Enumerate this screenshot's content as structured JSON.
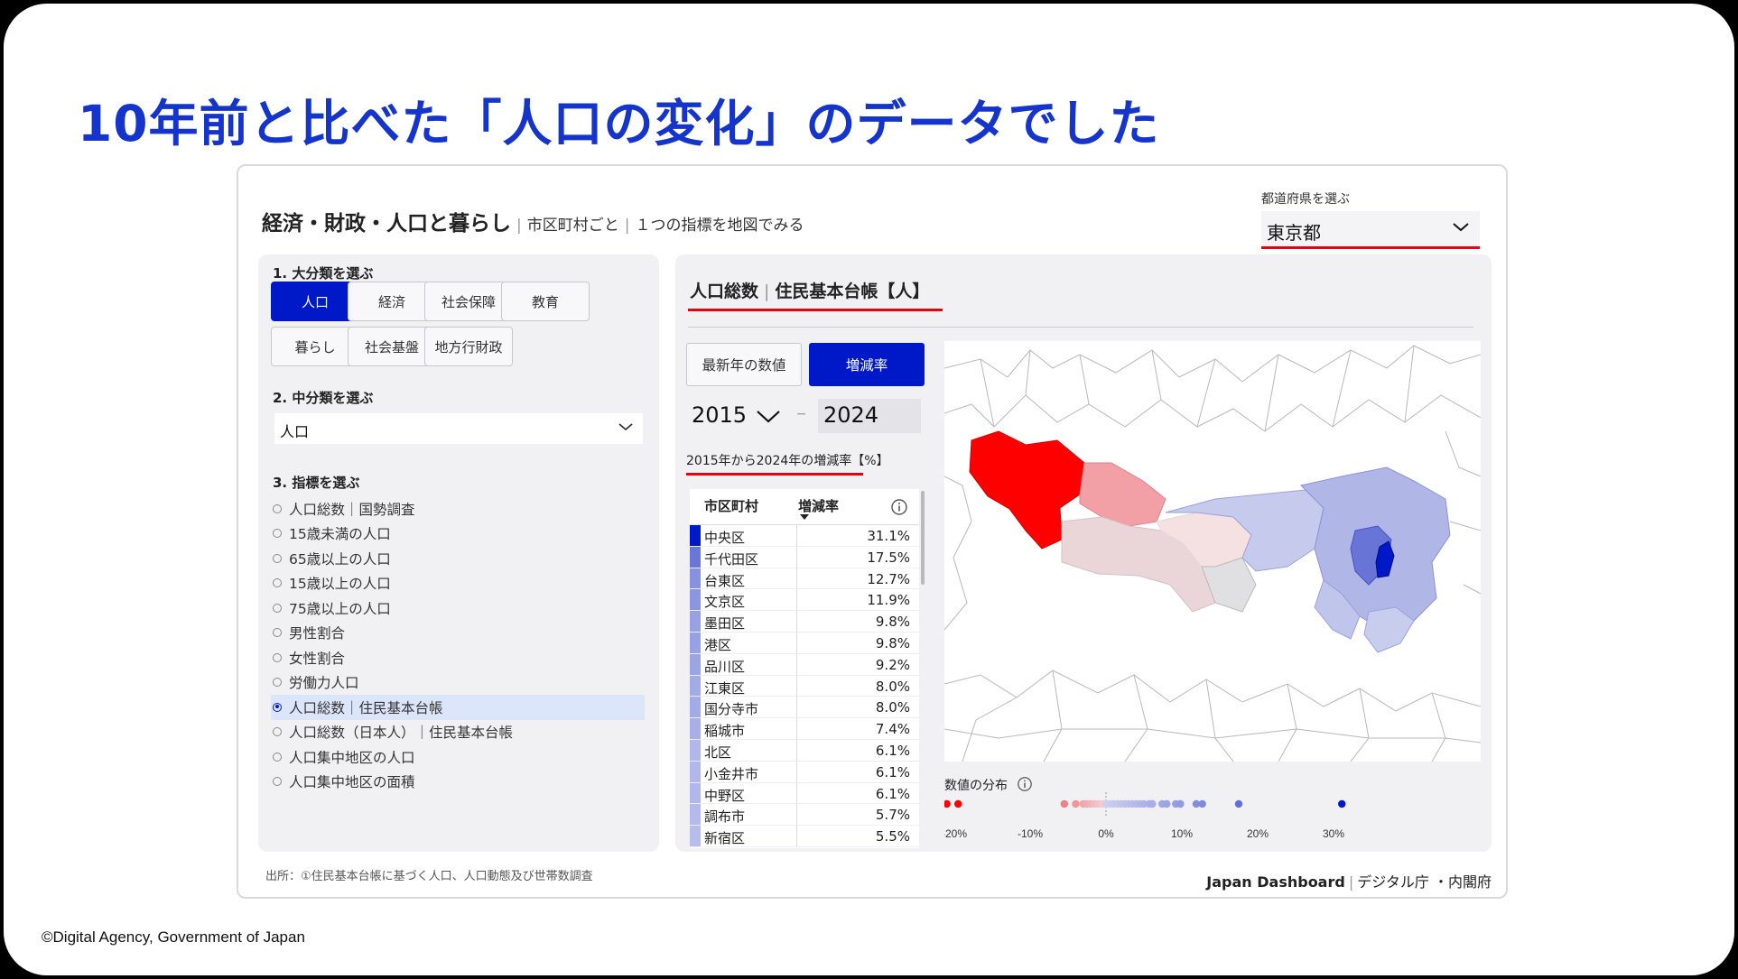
{
  "headline": "10年前と比べた「人口の変化」のデータでした",
  "credit": "©Digital Agency, Government of Japan",
  "dashboard": {
    "title_main": "経済・財政・人口と暮らし",
    "title_sub1": "市区町村ごと",
    "title_sub2": "１つの指標を地図でみる",
    "prefecture_label": "都道府県を選ぶ",
    "prefecture_value": "東京都",
    "step1_label": "1. 大分類を選ぶ",
    "categories": [
      "人口",
      "経済",
      "社会保障",
      "教育",
      "暮らし",
      "社会基盤",
      "地方行財政"
    ],
    "active_category": "人口",
    "step2_label": "2. 中分類を選ぶ",
    "subcategory_value": "人口",
    "step3_label": "3. 指標を選ぶ",
    "indicators": [
      "人口総数｜国勢調査",
      "15歳未満の人口",
      "65歳以上の人口",
      "15歳以上の人口",
      "75歳以上の人口",
      "男性割合",
      "女性割合",
      "労働力人口",
      "人口総数｜住民基本台帳",
      "人口総数（日本人）｜住民基本台帳",
      "人口集中地区の人口",
      "人口集中地区の面積"
    ],
    "selected_indicator_index": 8,
    "metric_title_main": "人口総数",
    "metric_title_sub": "住民基本台帳【人】",
    "toggle_latest": "最新年の数値",
    "toggle_change": "増減率",
    "year_from": "2015",
    "year_dash": "–",
    "year_to": "2024",
    "range_label": "2015年から2024年の増減率【%】",
    "table": {
      "col_name": "市区町村",
      "col_value": "増減率",
      "rows": [
        {
          "name": "中央区",
          "value": "31.1%",
          "color": "#0019c8"
        },
        {
          "name": "千代田区",
          "value": "17.5%",
          "color": "#6a77d9"
        },
        {
          "name": "台東区",
          "value": "12.7%",
          "color": "#8791de"
        },
        {
          "name": "文京区",
          "value": "11.9%",
          "color": "#8b95e0"
        },
        {
          "name": "墨田区",
          "value": "9.8%",
          "color": "#98a1e3"
        },
        {
          "name": "港区",
          "value": "9.8%",
          "color": "#98a1e3"
        },
        {
          "name": "品川区",
          "value": "9.2%",
          "color": "#9ca5e4"
        },
        {
          "name": "江東区",
          "value": "8.0%",
          "color": "#a3abe6"
        },
        {
          "name": "国分寺市",
          "value": "8.0%",
          "color": "#a3abe6"
        },
        {
          "name": "稲城市",
          "value": "7.4%",
          "color": "#a8afe7"
        },
        {
          "name": "北区",
          "value": "6.1%",
          "color": "#b1b7ea"
        },
        {
          "name": "小金井市",
          "value": "6.1%",
          "color": "#b1b7ea"
        },
        {
          "name": "中野区",
          "value": "6.1%",
          "color": "#b1b7ea"
        },
        {
          "name": "調布市",
          "value": "5.7%",
          "color": "#b4baeb"
        },
        {
          "name": "新宿区",
          "value": "5.5%",
          "color": "#b6bceb"
        }
      ]
    },
    "distribution_label": "数値の分布",
    "distribution_ticks": [
      "-20%",
      "-10%",
      "0%",
      "10%",
      "20%",
      "30%"
    ],
    "source": "出所：①住民基本台帳に基づく人口、人口動態及び世帯数調査",
    "brand_name": "Japan Dashboard",
    "brand_org": "デジタル庁 ・内閣府"
  },
  "colors": {
    "accent_blue": "#0019c8",
    "accent_red": "#e50012",
    "headline_blue": "#1434cb"
  },
  "icons": {
    "chevron": "chevron-down-icon",
    "info": "info-icon"
  }
}
